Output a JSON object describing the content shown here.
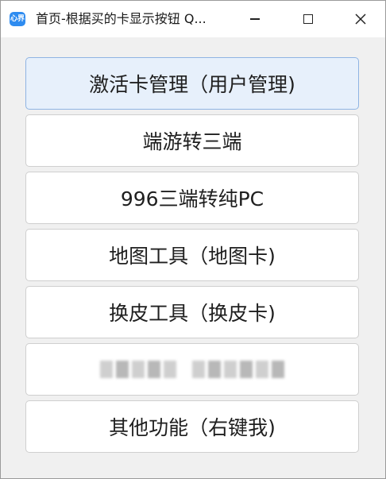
{
  "window": {
    "icon_text": "心界",
    "title": "首页-根据买的卡显示按钮 Q..."
  },
  "buttons": [
    {
      "label": "激活卡管理（用户管理)"
    },
    {
      "label": "端游转三端"
    },
    {
      "label": "996三端转纯PC"
    },
    {
      "label": "地图工具（地图卡)"
    },
    {
      "label": "换皮工具（换皮卡)"
    },
    {
      "label": ""
    },
    {
      "label": "其他功能（右键我)"
    }
  ]
}
